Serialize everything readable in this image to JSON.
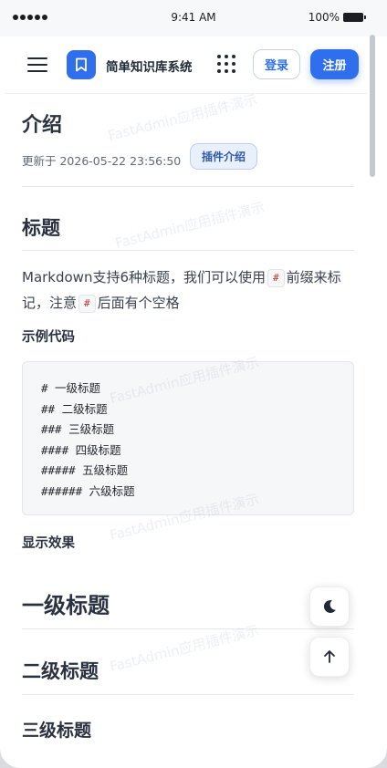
{
  "status_bar": {
    "time": "9:41 AM",
    "battery": "100%"
  },
  "navbar": {
    "brand": "简单知识库系统",
    "login_label": "登录",
    "register_label": "注册"
  },
  "article": {
    "title": "介绍",
    "updated": "更新于 2026-05-22 23:56:50",
    "tag": "插件介绍",
    "section_title": "标题",
    "para_part1": "Markdown支持6种标题，我们可以使用",
    "para_code1": "#",
    "para_part2": "前缀来标记，注意",
    "para_code2": "#",
    "para_part3": "后面有个空格",
    "example_label": "示例代码",
    "code_lines": [
      "# 一级标题",
      "## 二级标题",
      "### 三级标题",
      "#### 四级标题",
      "##### 五级标题",
      "###### 六级标题"
    ],
    "result_label": "显示效果",
    "demo_h1": "一级标题",
    "demo_h2": "二级标题",
    "demo_h3": "三级标题"
  },
  "watermark": "FastAdmin应用插件演示",
  "colors": {
    "primary": "#2f6fed",
    "heading": "#2a3140",
    "tag_bg": "#e8f0fb"
  },
  "icons": {
    "menu": "hamburger-icon",
    "logo": "bookmark-icon",
    "apps": "grid-dots-icon",
    "theme": "moon-icon",
    "top": "arrow-up-icon"
  }
}
